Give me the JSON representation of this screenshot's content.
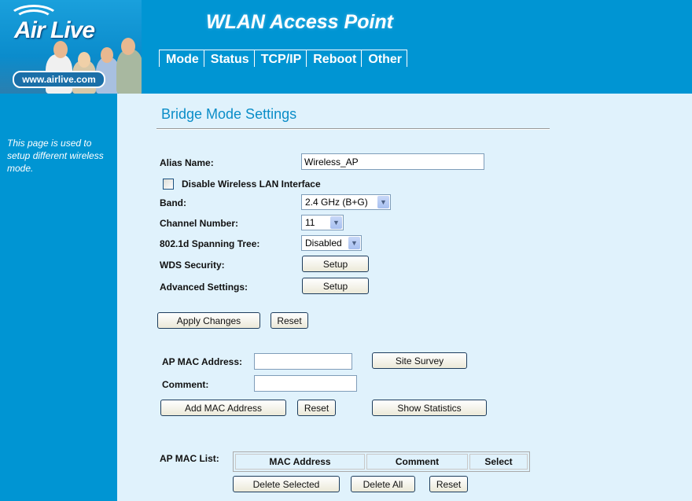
{
  "header": {
    "brand": "Air Live",
    "brand_url": "www.airlive.com",
    "app_title": "WLAN Access Point",
    "nav": [
      "Mode",
      "Status",
      "TCP/IP",
      "Reboot",
      "Other"
    ]
  },
  "sidebar": {
    "description": "This page is used to setup different wireless mode."
  },
  "page": {
    "title": "Bridge Mode Settings"
  },
  "form": {
    "alias_label": "Alias Name:",
    "alias_value": "Wireless_AP",
    "disable_wlan_label": "Disable Wireless LAN Interface",
    "disable_wlan_checked": false,
    "band_label": "Band:",
    "band_value": "2.4 GHz (B+G)",
    "channel_label": "Channel Number:",
    "channel_value": "11",
    "stp_label": "802.1d Spanning Tree:",
    "stp_value": "Disabled",
    "wds_security_label": "WDS Security:",
    "wds_security_button": "Setup",
    "advanced_label": "Advanced Settings:",
    "advanced_button": "Setup",
    "apply_button": "Apply Changes",
    "reset_button": "Reset"
  },
  "mac": {
    "ap_mac_label": "AP MAC Address:",
    "ap_mac_value": "",
    "comment_label": "Comment:",
    "comment_value": "",
    "site_survey_button": "Site Survey",
    "add_mac_button": "Add MAC Address",
    "reset_button": "Reset",
    "show_stats_button": "Show Statistics"
  },
  "mac_list": {
    "label": "AP MAC List:",
    "columns": [
      "MAC Address",
      "Comment",
      "Select"
    ],
    "rows": [],
    "delete_selected_button": "Delete Selected",
    "delete_all_button": "Delete All",
    "reset_button": "Reset"
  }
}
